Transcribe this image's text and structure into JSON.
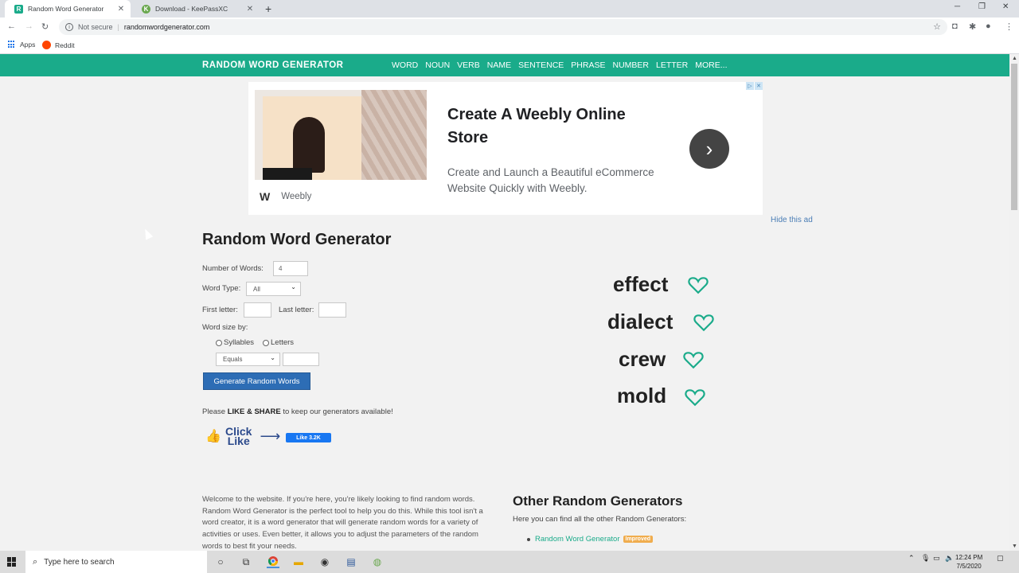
{
  "browser": {
    "tabs": [
      {
        "title": "Random Word Generator",
        "favicon": "R"
      },
      {
        "title": "Download - KeePassXC",
        "favicon": "K"
      }
    ],
    "new_tab": "+",
    "window_controls": {
      "minimize": "─",
      "restore": "❐",
      "close": "✕"
    },
    "security": "Not secure",
    "url": "randomwordgenerator.com",
    "bookmarks": [
      {
        "label": "Apps"
      },
      {
        "label": "Reddit"
      }
    ]
  },
  "site": {
    "brand": "RANDOM WORD GENERATOR",
    "nav": [
      "WORD",
      "NOUN",
      "VERB",
      "NAME",
      "SENTENCE",
      "PHRASE",
      "NUMBER",
      "LETTER",
      "MORE..."
    ],
    "accent": "#1aab8a"
  },
  "ad": {
    "headline": "Create A Weebly Online Store",
    "description": "Create and Launch a Beautiful eCommerce Website Quickly with Weebly.",
    "brand": "Weebly",
    "hide_label": "Hide this ad"
  },
  "form": {
    "title": "Random Word Generator",
    "number_of_words_label": "Number of Words:",
    "number_of_words_value": "4",
    "word_type_label": "Word Type:",
    "word_type_value": "All",
    "first_letter_label": "First letter:",
    "last_letter_label": "Last letter:",
    "word_size_label": "Word size by:",
    "syllables_label": "Syllables",
    "letters_label": "Letters",
    "size_operator_value": "Equals",
    "generate_label": "Generate Random Words",
    "please_prefix": "Please ",
    "please_bold": "LIKE & SHARE",
    "please_suffix": " to keep our generators available!",
    "click_label": "Click",
    "like_label": "Like",
    "fb_like": "Like 3.2K"
  },
  "results": [
    "effect",
    "dialect",
    "crew",
    "mold"
  ],
  "content": {
    "welcome": "Welcome to the website. If you're here, you're likely looking to find random words. Random Word Generator is the perfect tool to help you do this. While this tool isn't a word creator, it is a word generator that will generate random words for a variety of activities or uses. Even better, it allows you to adjust the parameters of the random words to best fit your needs.",
    "other_title": "Other Random Generators",
    "other_sub": "Here you can find all the other Random Generators:",
    "other_items": [
      {
        "label": "Random Word Generator",
        "badge": "Improved"
      }
    ]
  },
  "taskbar": {
    "search_placeholder": "Type here to search",
    "time": "12:24 PM",
    "date": "7/5/2020"
  }
}
